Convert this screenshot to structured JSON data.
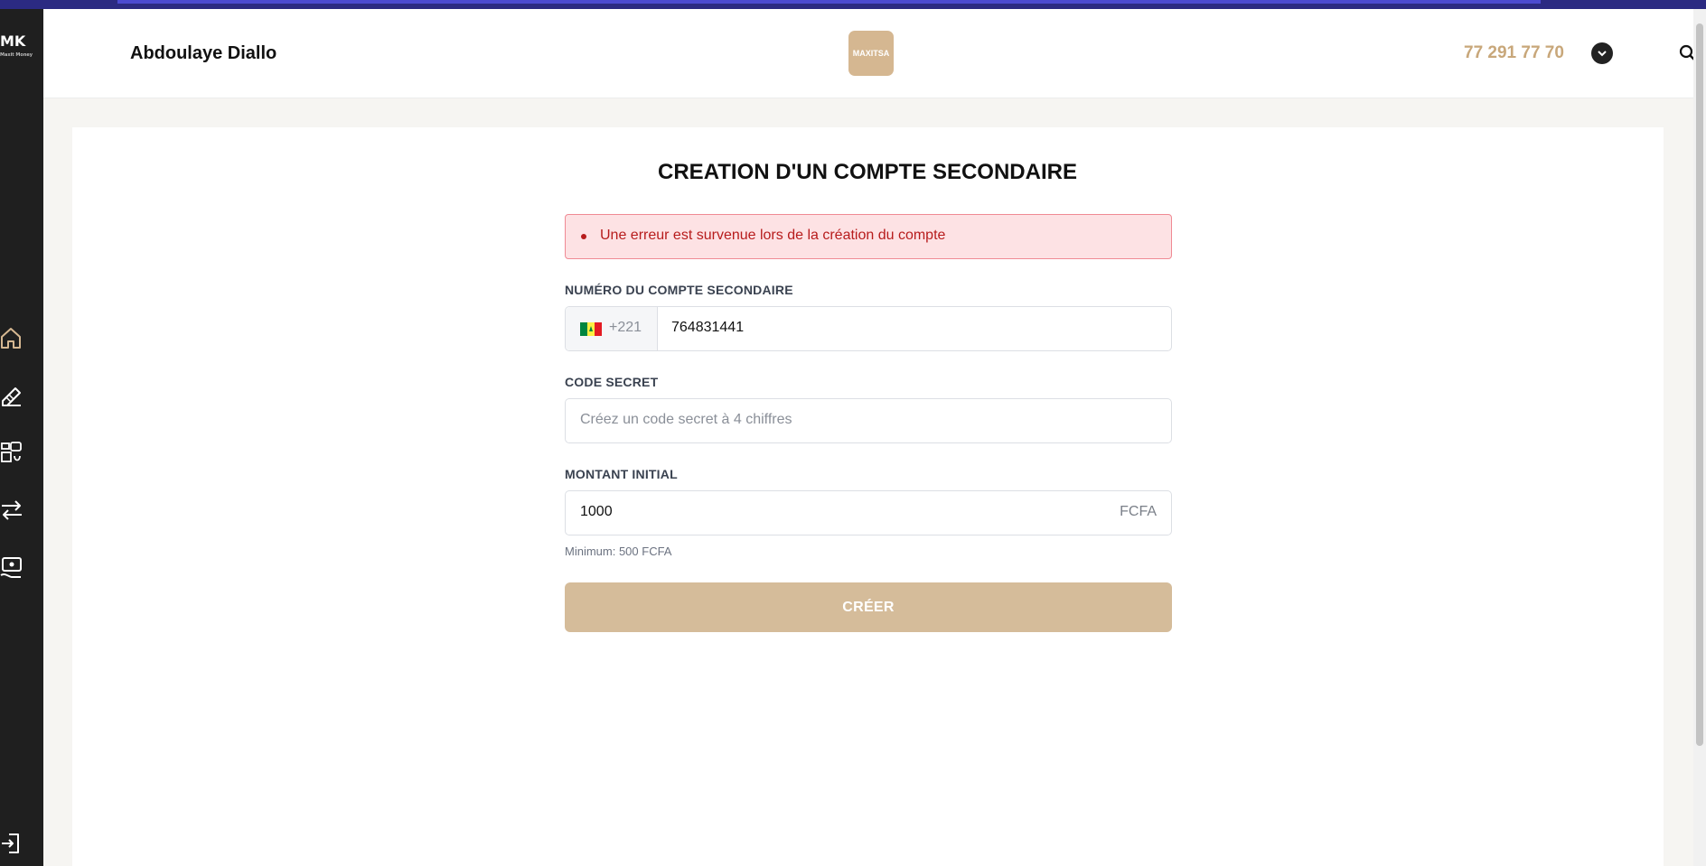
{
  "header": {
    "user_name": "Abdoulaye Diallo",
    "brand_logo_text": "MAXITSA",
    "phone": "77 291 77 70"
  },
  "sidebar": {
    "logo_text": "MK",
    "logo_subtitle": "Maxit Money",
    "items": [
      {
        "icon": "home-icon",
        "active": true
      },
      {
        "icon": "edit-icon"
      },
      {
        "icon": "accounts-icon"
      },
      {
        "icon": "transfer-icon"
      },
      {
        "icon": "payment-icon"
      },
      {
        "icon": "logout-icon"
      }
    ]
  },
  "form": {
    "title": "CREATION D'UN COMPTE SECONDAIRE",
    "error_message": "Une erreur est survenue lors de la création du compte",
    "account_number_label": "NUMÉRO DU COMPTE SECONDAIRE",
    "country_code": "+221",
    "account_number_value": "764831441",
    "secret_code_label": "CODE SECRET",
    "secret_code_placeholder": "Créez un code secret à 4 chiffres",
    "initial_amount_label": "MONTANT INITIAL",
    "initial_amount_value": "1000",
    "currency": "FCFA",
    "minimum_hint": "Minimum: 500 FCFA",
    "submit_label": "CRÉER"
  },
  "colors": {
    "accent": "#d5bc9a",
    "phone_text": "#c8a77a",
    "error_bg": "#fde2e4",
    "error_text": "#b71c1c",
    "sidebar_bg": "#1f1f1f"
  }
}
